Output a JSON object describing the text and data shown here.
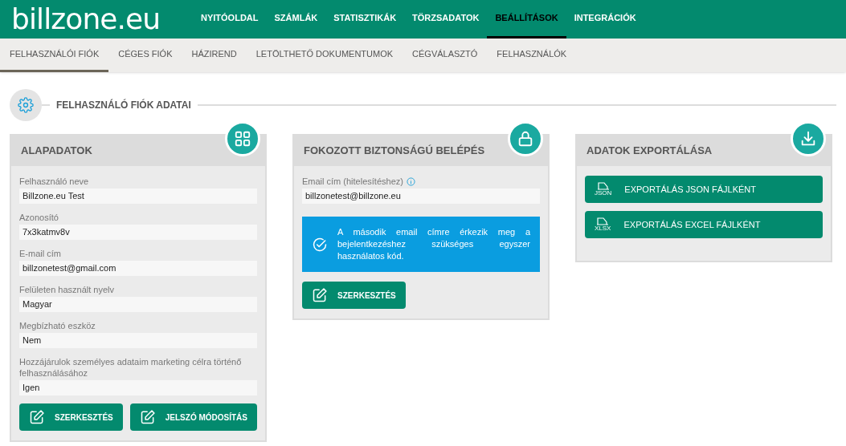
{
  "header": {
    "logo": "billzone.eu",
    "nav": [
      {
        "label": "NYITÓOLDAL",
        "selected": false
      },
      {
        "label": "SZÁMLÁK",
        "selected": false
      },
      {
        "label": "STATISZTIKÁK",
        "selected": false
      },
      {
        "label": "TÖRZSADATOK",
        "selected": false
      },
      {
        "label": "BEÁLLÍTÁSOK",
        "selected": true
      },
      {
        "label": "INTEGRÁCIÓK",
        "selected": false
      }
    ]
  },
  "subnav": [
    {
      "label": "FELHASZNÁLÓI FIÓK",
      "selected": true
    },
    {
      "label": "CÉGES FIÓK",
      "selected": false
    },
    {
      "label": "HÁZIREND",
      "selected": false
    },
    {
      "label": "LETÖLTHETŐ DOKUMENTUMOK",
      "selected": false
    },
    {
      "label": "CÉGVÁLASZTÓ",
      "selected": false
    },
    {
      "label": "FELHASZNÁLÓK",
      "selected": false
    }
  ],
  "section_title": "FELHASZNÁLÓ FIÓK ADATAI",
  "cards": [
    {
      "title": "ALAPADATOK",
      "kind": "grid",
      "fields": [
        {
          "label": "Felhasználó neve",
          "value": "Billzone.eu Test"
        },
        {
          "label": "Azonosító",
          "value": "7x3katmv8v"
        },
        {
          "label": "E-mail cím",
          "value": "billzonetest@gmail.com"
        },
        {
          "label": "Felületen használt nyelv",
          "value": "Magyar"
        },
        {
          "label": "Megbízható eszköz",
          "value": "Nem"
        },
        {
          "label": "Hozzájárulok személyes adataim marketing célra történő felhasználásához",
          "value": "Igen"
        }
      ],
      "buttons": [
        {
          "label": "SZERKESZTÉS",
          "kind": "edit"
        },
        {
          "label": "JELSZÓ MÓDOSÍTÁS",
          "kind": "edit"
        }
      ]
    },
    {
      "title": "FOKOZOTT BIZTONSÁGÚ BELÉPÉS",
      "kind": "lock",
      "fields": [
        {
          "label": "Email cím (hitelesítéshez)",
          "value": "billzonetest@billzone.eu",
          "info": true
        }
      ],
      "notice": "A második email címre érkezik meg a bejelentkezéshez szükséges egyszer használatos kód.",
      "buttons": [
        {
          "label": "SZERKESZTÉS",
          "kind": "edit"
        }
      ]
    },
    {
      "title": "ADATOK EXPORTÁLÁSA",
      "kind": "download",
      "buttons": [
        {
          "label": "EXPORTÁLÁS JSON FÁJLKÉNT",
          "kind": "file",
          "file_type": "JSON"
        },
        {
          "label": "EXPORTÁLÁS EXCEL FÁJLKÉNT",
          "kind": "file",
          "file_type": "XLSX"
        }
      ]
    }
  ]
}
